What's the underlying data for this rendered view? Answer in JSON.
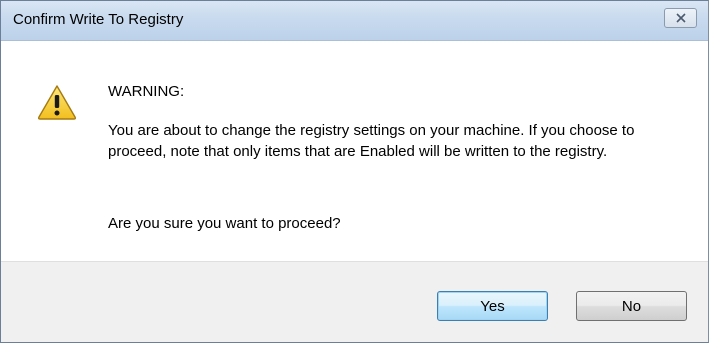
{
  "window": {
    "title": "Confirm Write To Registry"
  },
  "icons": {
    "close": "close-icon",
    "warning": "warning-icon"
  },
  "dialog": {
    "heading": "WARNING:",
    "message": "You are about to change the registry settings on your machine. If you choose to proceed, note that only items that are Enabled will be written to the registry.",
    "question": "Are you sure you want to proceed?"
  },
  "buttons": {
    "yes_label": "Yes",
    "no_label": "No"
  },
  "colors": {
    "titlebar": "#c8daee",
    "footer": "#f0f0f0",
    "default_button_border": "#3c7fb1",
    "warning_fill": "#f7d233"
  }
}
